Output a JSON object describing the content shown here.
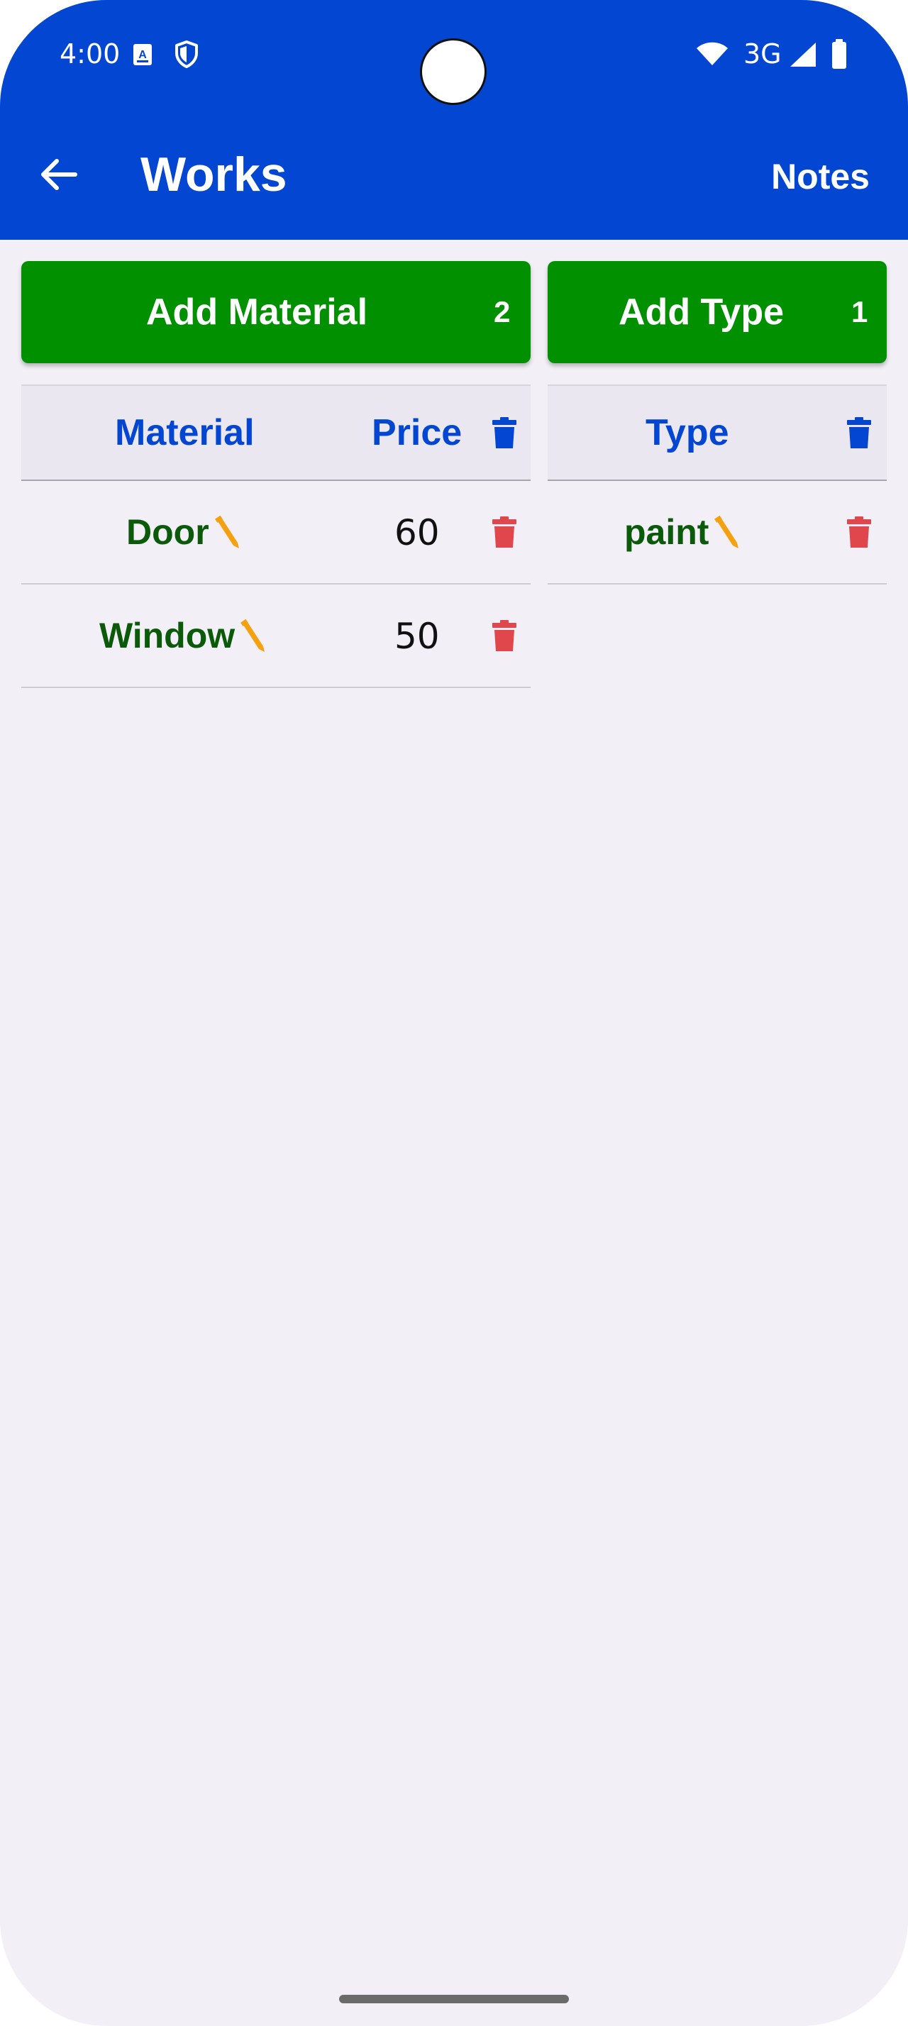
{
  "status_bar": {
    "time": "4:00",
    "network": "3G"
  },
  "toolbar": {
    "title": "Works",
    "notes_label": "Notes"
  },
  "add_material_button": {
    "label": "Add Material",
    "count": "2"
  },
  "add_type_button": {
    "label": "Add Type",
    "count": "1"
  },
  "materials_table": {
    "headers": {
      "material": "Material",
      "price": "Price"
    },
    "rows": [
      {
        "name": "Door",
        "price": "60"
      },
      {
        "name": "Window",
        "price": "50"
      }
    ]
  },
  "types_table": {
    "headers": {
      "type": "Type"
    },
    "rows": [
      {
        "name": "paint"
      }
    ]
  },
  "colors": {
    "primary": "#0346d2",
    "button_green": "#009000",
    "name_green": "#0a5a0a",
    "delete_red": "#e0474c",
    "pencil_orange": "#f5a00f",
    "background": "#f3eff7"
  },
  "icons": {
    "back": "arrow-left-icon",
    "delete_all": "trash-icon",
    "delete_row": "trash-icon",
    "edit": "pencil-icon"
  }
}
